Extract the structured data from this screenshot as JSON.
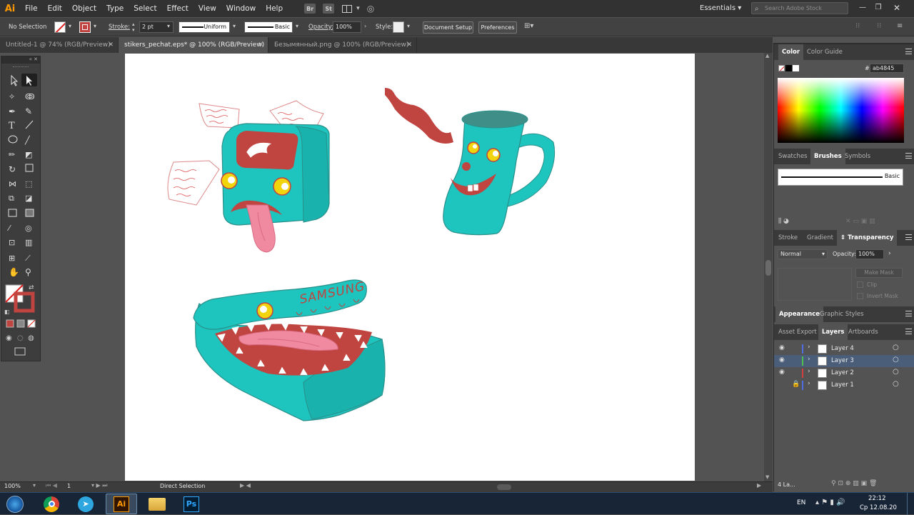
{
  "app": {
    "logo": "Ai"
  },
  "menu": [
    "File",
    "Edit",
    "Object",
    "Type",
    "Select",
    "Effect",
    "View",
    "Window",
    "Help"
  ],
  "menubar_icons": {
    "bridge": "Br",
    "stock": "St"
  },
  "workspace": "Essentials",
  "search_placeholder": "Search Adobe Stock",
  "control": {
    "selection": "No Selection",
    "stroke_label": "Stroke:",
    "stroke_value": "2 pt",
    "profile": "Uniform",
    "brush": "Basic",
    "opacity_label": "Opacity:",
    "opacity_value": "100%",
    "style_label": "Style:",
    "doc_setup": "Document Setup",
    "preferences": "Preferences"
  },
  "tabs": [
    {
      "label": "Untitled-1 @ 74% (RGB/Preview)"
    },
    {
      "label": "stikers_pechat.eps* @ 100% (RGB/Preview)"
    },
    {
      "label": "Безымянный.png @ 100% (RGB/Preview)"
    }
  ],
  "artwork": {
    "brand_text": "SAMSUNG"
  },
  "color_panel": {
    "tabs": [
      "Color",
      "Color Guide"
    ],
    "hash": "#",
    "hex": "ab4845"
  },
  "brushes_panel": {
    "tabs": [
      "Swatches",
      "Brushes",
      "Symbols"
    ],
    "brush_name": "Basic"
  },
  "transparency_panel": {
    "tabs": [
      "Stroke",
      "Gradient",
      "Transparency"
    ],
    "mode": "Normal",
    "opacity_label": "Opacity:",
    "opacity": "100%",
    "make_mask": "Make Mask",
    "clip": "Clip",
    "invert": "Invert Mask"
  },
  "appearance_tabs": [
    "Appearance",
    "Graphic Styles"
  ],
  "layers_tabs": [
    "Asset Export",
    "Layers",
    "Artboards"
  ],
  "layers": [
    {
      "name": "Layer 4",
      "color": "#4f6fe0",
      "visible": true,
      "locked": false,
      "selected": false
    },
    {
      "name": "Layer 3",
      "color": "#4fc04f",
      "visible": true,
      "locked": false,
      "selected": true
    },
    {
      "name": "Layer 2",
      "color": "#d04040",
      "visible": true,
      "locked": false,
      "selected": false
    },
    {
      "name": "Layer 1",
      "color": "#4f6fe0",
      "visible": false,
      "locked": true,
      "selected": false
    }
  ],
  "layers_count": "4 La...",
  "status": {
    "zoom": "100%",
    "artboard": "1",
    "tool": "Direct Selection"
  },
  "taskbar": {
    "lang": "EN",
    "time": "22:12",
    "date": "Ср 12.08.20",
    "ai": "Ai",
    "ps": "Ps"
  },
  "colors": {
    "teal": "#1ec5bf",
    "red": "#c0443f",
    "pink": "#f08aa0",
    "yellow": "#f2d40c",
    "jug_top": "#3f8f88"
  }
}
